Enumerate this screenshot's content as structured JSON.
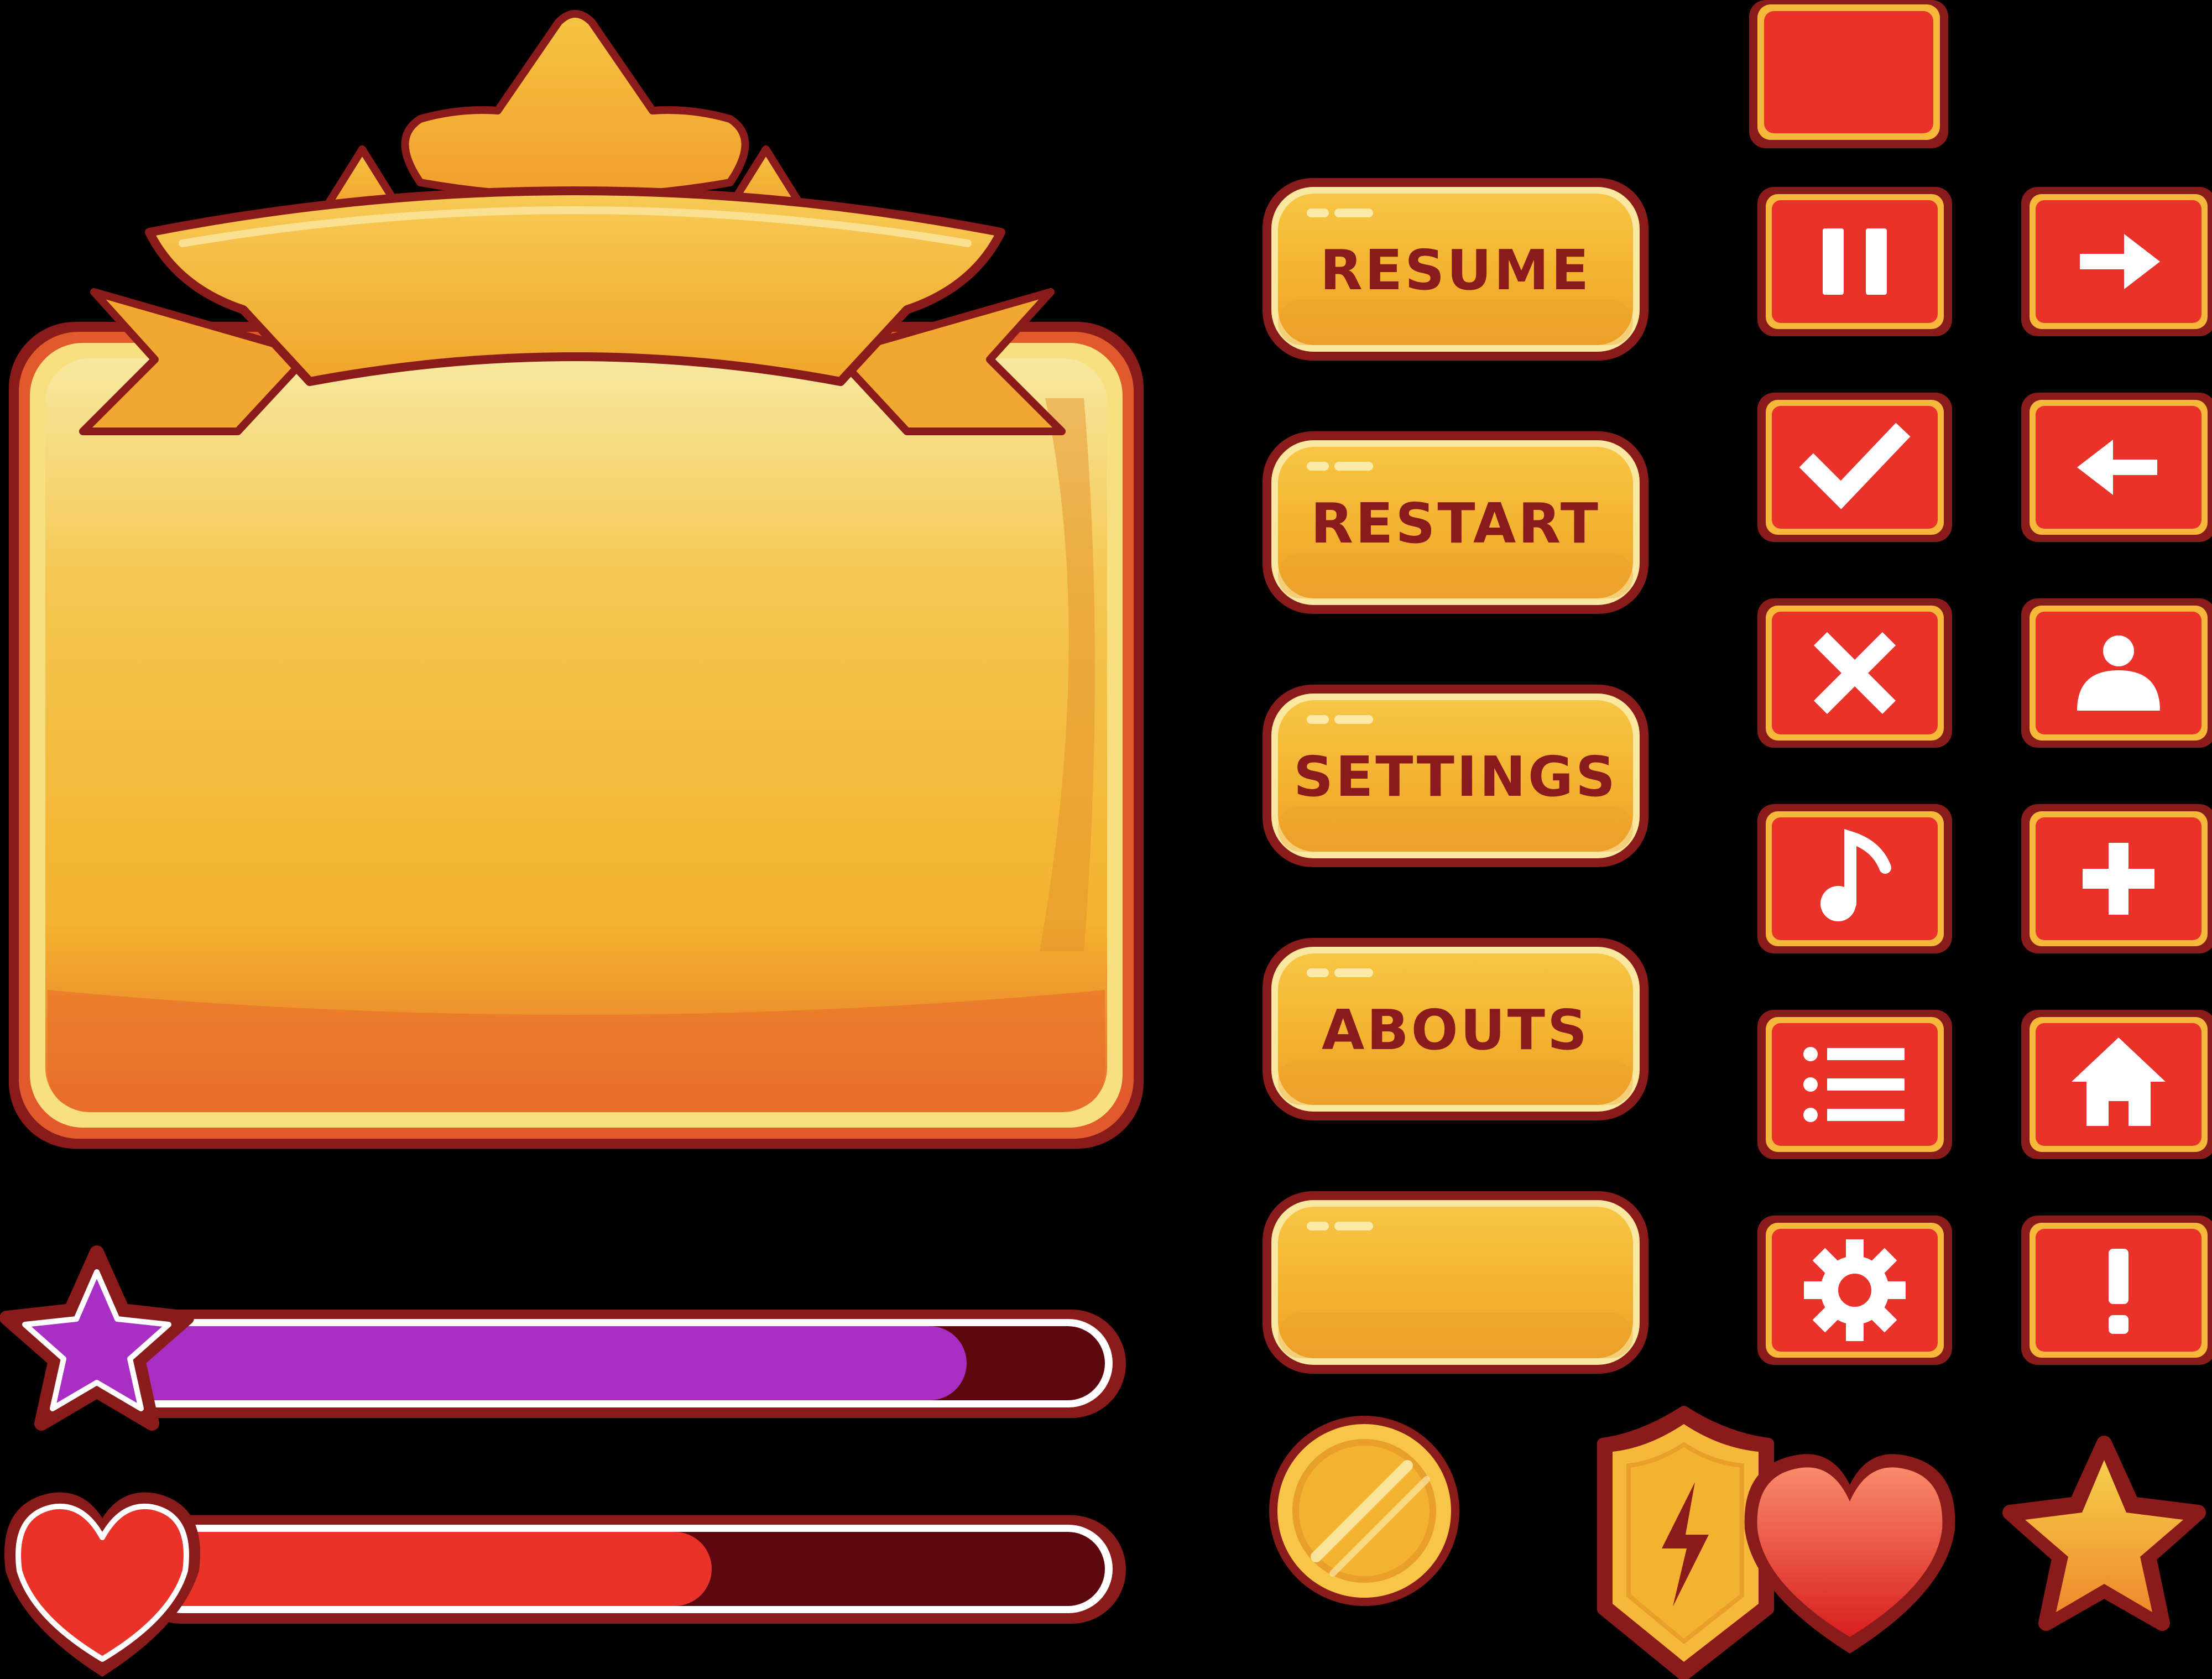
{
  "colors": {
    "background": "#000000",
    "outline_dark": "#8b1a1a",
    "gold_light": "#f8e39a",
    "gold": "#f3b22f",
    "gold_dark": "#e8702a",
    "icon_red": "#e8322a",
    "icon_white": "#ffffff",
    "star_bar_fill": "#a92ec4",
    "heart_bar_fill": "#e8322a",
    "bar_track": "#5e060d"
  },
  "panel": {
    "name": "ribbon-panel",
    "content_text": ""
  },
  "menu_buttons": [
    {
      "id": "resume",
      "label": "RESUME"
    },
    {
      "id": "restart",
      "label": "RESTART"
    },
    {
      "id": "settings",
      "label": "SETTINGS"
    },
    {
      "id": "abouts",
      "label": "ABOUTS"
    },
    {
      "id": "blank",
      "label": ""
    }
  ],
  "icon_buttons": {
    "top_blank": "blank-square",
    "left_column": [
      "pause-icon",
      "check-icon",
      "close-icon",
      "music-icon",
      "list-icon",
      "gear-icon"
    ],
    "right_column": [
      "arrow-right-icon",
      "arrow-left-icon",
      "user-icon",
      "plus-icon",
      "home-icon",
      "exclamation-icon"
    ]
  },
  "progress_bars": [
    {
      "id": "star-bar",
      "icon": "star-icon",
      "fill_color": "#a92ec4",
      "progress": 0.86
    },
    {
      "id": "heart-bar",
      "icon": "heart-icon",
      "fill_color": "#e8322a",
      "progress": 0.59
    }
  ],
  "collectibles": [
    "coin-icon",
    "lightning-shield-icon",
    "heart-icon",
    "star-icon"
  ]
}
